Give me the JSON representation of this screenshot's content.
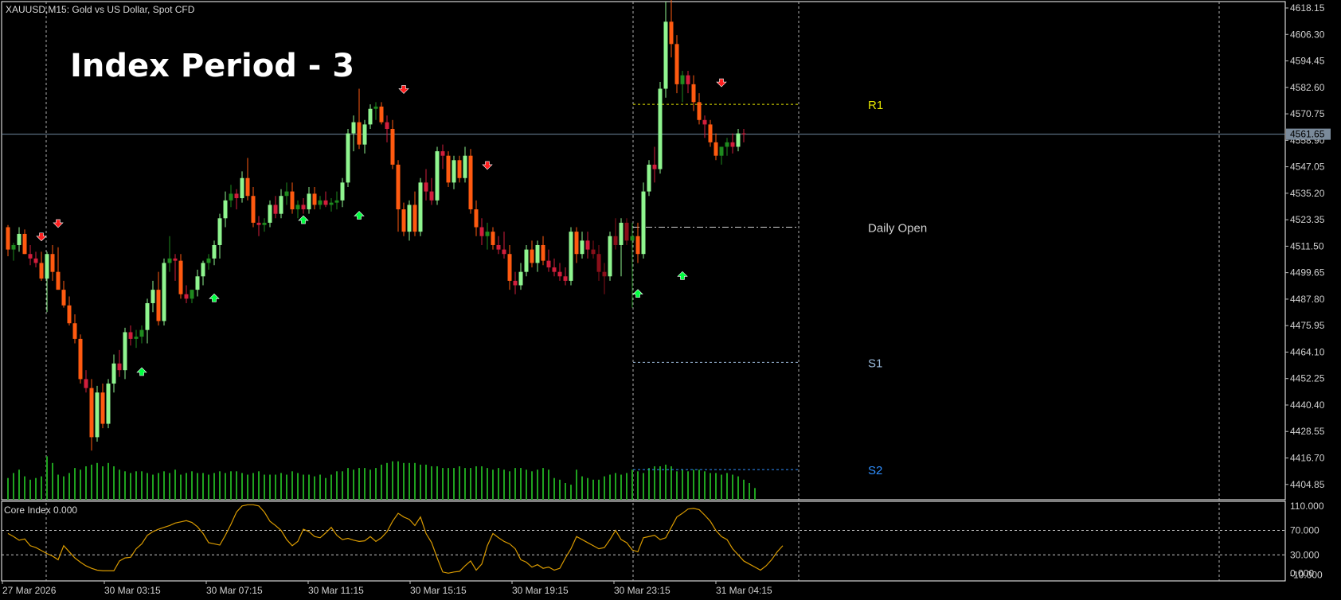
{
  "header": {
    "symbol_info": "XAUUSD,M15:  Gold vs US Dollar, Spot CFD",
    "overlay_title": "Index Period - 3"
  },
  "colors": {
    "bull_strong": "#8ff58f",
    "bull": "#1e8a1e",
    "bear_strong": "#ff5a10",
    "bear": "#d21e3c",
    "bear_dark": "#8a0f1a",
    "buy_arrow": "#00ff40",
    "sell_arrow": "#ff2020",
    "r1": "#e6e600",
    "s1": "#9ab8d8",
    "s2": "#2f8fff",
    "daily_open": "#d0d0d0",
    "core_line": "#d99a00",
    "volume": "#1fa31f"
  },
  "chart_data": {
    "type": "candlestick",
    "symbol": "XAUUSD",
    "timeframe": "M15",
    "current_price": "4561.65",
    "y_axis_ticks": [
      "4618.15",
      "4606.30",
      "4594.45",
      "4582.60",
      "4570.75",
      "4558.90",
      "4547.05",
      "4535.20",
      "4523.35",
      "4511.50",
      "4499.65",
      "4487.80",
      "4475.95",
      "4464.10",
      "4452.25",
      "4440.40",
      "4428.55",
      "4416.70",
      "4404.85"
    ],
    "ylim": [
      4398,
      4621
    ],
    "x_axis_labels": [
      "27 Mar 2026",
      "30 Mar 03:15",
      "30 Mar 07:15",
      "30 Mar 11:15",
      "30 Mar 15:15",
      "30 Mar 19:15",
      "30 Mar 23:15",
      "31 Mar 04:15"
    ],
    "pivot_levels": [
      {
        "name": "R1",
        "value": 4575.0
      },
      {
        "name": "Daily Open",
        "value": 4520.0
      },
      {
        "name": "S1",
        "value": 4459.5
      },
      {
        "name": "S2",
        "value": 4411.5
      }
    ],
    "candles": [
      [
        4520,
        4521,
        4507,
        4510
      ],
      [
        4510,
        4513,
        4505,
        4512
      ],
      [
        4512,
        4520,
        4509,
        4517
      ],
      [
        4517,
        4519,
        4508,
        4508
      ],
      [
        4508,
        4512,
        4503,
        4506
      ],
      [
        4506,
        4509,
        4502,
        4504
      ],
      [
        4504,
        4509,
        4496,
        4497
      ],
      [
        4497,
        4509,
        4482,
        4508
      ],
      [
        4508,
        4512,
        4496,
        4500
      ],
      [
        4500,
        4511,
        4492,
        4492
      ],
      [
        4492,
        4496,
        4484,
        4485
      ],
      [
        4485,
        4489,
        4476,
        4477
      ],
      [
        4477,
        4481,
        4468,
        4470
      ],
      [
        4470,
        4472,
        4450,
        4452
      ],
      [
        4452,
        4456,
        4446,
        4448
      ],
      [
        4448,
        4452,
        4420,
        4426
      ],
      [
        4426,
        4449,
        4424,
        4446
      ],
      [
        4446,
        4450,
        4430,
        4432
      ],
      [
        4432,
        4452,
        4430,
        4450
      ],
      [
        4450,
        4463,
        4446,
        4459
      ],
      [
        4459,
        4465,
        4453,
        4456
      ],
      [
        4456,
        4475,
        4452,
        4473
      ],
      [
        4473,
        4476,
        4467,
        4470
      ],
      [
        4470,
        4474,
        4466,
        4471
      ],
      [
        4471,
        4476,
        4468,
        4474
      ],
      [
        4474,
        4488,
        4468,
        4486
      ],
      [
        4486,
        4496,
        4482,
        4492
      ],
      [
        4492,
        4500,
        4476,
        4478
      ],
      [
        4478,
        4506,
        4476,
        4504
      ],
      [
        4504,
        4516,
        4500,
        4506
      ],
      [
        4506,
        4508,
        4496,
        4505
      ],
      [
        4505,
        4508,
        4488,
        4490
      ],
      [
        4490,
        4494,
        4486,
        4488
      ],
      [
        4488,
        4492,
        4486,
        4492
      ],
      [
        4492,
        4501,
        4489,
        4498
      ],
      [
        4498,
        4505,
        4494,
        4504
      ],
      [
        4504,
        4508,
        4501,
        4506
      ],
      [
        4506,
        4514,
        4503,
        4512
      ],
      [
        4512,
        4526,
        4506,
        4524
      ],
      [
        4524,
        4536,
        4520,
        4532
      ],
      [
        4532,
        4539,
        4529,
        4535
      ],
      [
        4535,
        4537,
        4528,
        4533
      ],
      [
        4533,
        4545,
        4531,
        4542
      ],
      [
        4542,
        4551,
        4532,
        4534
      ],
      [
        4534,
        4538,
        4520,
        4522
      ],
      [
        4522,
        4525,
        4516,
        4521
      ],
      [
        4521,
        4524,
        4518,
        4522
      ],
      [
        4522,
        4532,
        4520,
        4530
      ],
      [
        4530,
        4534,
        4524,
        4526
      ],
      [
        4526,
        4537,
        4524,
        4534
      ],
      [
        4534,
        4540,
        4530,
        4536
      ],
      [
        4536,
        4540,
        4526,
        4528
      ],
      [
        4528,
        4532,
        4524,
        4530
      ],
      [
        4530,
        4533,
        4526,
        4528
      ],
      [
        4528,
        4538,
        4526,
        4535
      ],
      [
        4535,
        4538,
        4528,
        4530
      ],
      [
        4530,
        4534,
        4528,
        4532
      ],
      [
        4532,
        4536,
        4529,
        4530
      ],
      [
        4530,
        4533,
        4527,
        4531
      ],
      [
        4531,
        4536,
        4528,
        4532
      ],
      [
        4532,
        4542,
        4529,
        4540
      ],
      [
        4540,
        4564,
        4538,
        4562
      ],
      [
        4562,
        4570,
        4554,
        4567
      ],
      [
        4567,
        4582,
        4555,
        4557
      ],
      [
        4557,
        4568,
        4553,
        4566
      ],
      [
        4566,
        4575,
        4564,
        4573
      ],
      [
        4573,
        4576,
        4568,
        4574
      ],
      [
        4574,
        4576,
        4566,
        4567
      ],
      [
        4567,
        4570,
        4558,
        4564
      ],
      [
        4564,
        4568,
        4546,
        4548
      ],
      [
        4548,
        4550,
        4518,
        4528
      ],
      [
        4528,
        4531,
        4516,
        4518
      ],
      [
        4518,
        4532,
        4514,
        4530
      ],
      [
        4530,
        4536,
        4516,
        4518
      ],
      [
        4518,
        4542,
        4516,
        4540
      ],
      [
        4540,
        4546,
        4532,
        4536
      ],
      [
        4536,
        4542,
        4530,
        4532
      ],
      [
        4532,
        4556,
        4530,
        4554
      ],
      [
        4554,
        4557,
        4546,
        4552
      ],
      [
        4552,
        4554,
        4538,
        4540
      ],
      [
        4540,
        4552,
        4537,
        4550
      ],
      [
        4550,
        4552,
        4540,
        4542
      ],
      [
        4542,
        4556,
        4540,
        4552
      ],
      [
        4552,
        4555,
        4526,
        4528
      ],
      [
        4528,
        4532,
        4516,
        4520
      ],
      [
        4520,
        4524,
        4512,
        4516
      ],
      [
        4516,
        4522,
        4510,
        4518
      ],
      [
        4518,
        4520,
        4510,
        4512
      ],
      [
        4512,
        4516,
        4508,
        4510
      ],
      [
        4510,
        4518,
        4506,
        4508
      ],
      [
        4508,
        4512,
        4492,
        4496
      ],
      [
        4496,
        4500,
        4490,
        4494
      ],
      [
        4494,
        4504,
        4492,
        4500
      ],
      [
        4500,
        4512,
        4498,
        4510
      ],
      [
        4510,
        4514,
        4502,
        4504
      ],
      [
        4504,
        4514,
        4500,
        4512
      ],
      [
        4512,
        4516,
        4503,
        4505
      ],
      [
        4505,
        4510,
        4500,
        4502
      ],
      [
        4502,
        4506,
        4498,
        4500
      ],
      [
        4500,
        4504,
        4496,
        4498
      ],
      [
        4498,
        4502,
        4494,
        4496
      ],
      [
        4496,
        4520,
        4494,
        4518
      ],
      [
        4518,
        4520,
        4504,
        4508
      ],
      [
        4508,
        4518,
        4506,
        4514
      ],
      [
        4514,
        4518,
        4506,
        4510
      ],
      [
        4510,
        4514,
        4506,
        4508
      ],
      [
        4508,
        4512,
        4496,
        4500
      ],
      [
        4500,
        4504,
        4490,
        4498
      ],
      [
        4498,
        4518,
        4496,
        4516
      ],
      [
        4516,
        4524,
        4510,
        4512
      ],
      [
        4512,
        4524,
        4498,
        4522
      ],
      [
        4522,
        4524,
        4512,
        4514
      ],
      [
        4514,
        4522,
        4484,
        4516
      ],
      [
        4516,
        4522,
        4504,
        4508
      ],
      [
        4508,
        4540,
        4506,
        4536
      ],
      [
        4536,
        4550,
        4534,
        4548
      ],
      [
        4548,
        4556,
        4540,
        4546
      ],
      [
        4546,
        4585,
        4544,
        4582
      ],
      [
        4582,
        4621,
        4578,
        4612
      ],
      [
        4612,
        4622,
        4596,
        4602
      ],
      [
        4602,
        4606,
        4580,
        4584
      ],
      [
        4584,
        4590,
        4576,
        4588
      ],
      [
        4588,
        4590,
        4580,
        4584
      ],
      [
        4584,
        4588,
        4572,
        4576
      ],
      [
        4576,
        4580,
        4566,
        4568
      ],
      [
        4568,
        4570,
        4560,
        4566
      ],
      [
        4566,
        4568,
        4556,
        4558
      ],
      [
        4558,
        4562,
        4550,
        4552
      ],
      [
        4552,
        4556,
        4548,
        4556
      ],
      [
        4556,
        4560,
        4552,
        4558
      ],
      [
        4558,
        4562,
        4553,
        4556
      ],
      [
        4556,
        4564,
        4554,
        4562
      ],
      [
        4562,
        4564,
        4558,
        4561.65
      ]
    ],
    "volume": [
      13,
      16,
      18,
      14,
      12,
      13,
      14,
      26,
      22,
      15,
      14,
      16,
      19,
      18,
      20,
      21,
      22,
      20,
      22,
      20,
      18,
      17,
      16,
      17,
      17,
      16,
      15,
      16,
      17,
      16,
      18,
      15,
      16,
      17,
      16,
      16,
      15,
      16,
      17,
      16,
      17,
      17,
      16,
      15,
      16,
      17,
      15,
      15,
      15,
      16,
      15,
      17,
      16,
      15,
      15,
      14,
      15,
      13,
      15,
      17,
      17,
      19,
      18,
      19,
      19,
      18,
      19,
      21,
      22,
      23,
      23,
      22,
      22,
      22,
      21,
      21,
      20,
      20,
      19,
      19,
      19,
      20,
      19,
      19,
      20,
      20,
      19,
      18,
      19,
      18,
      17,
      19,
      19,
      18,
      17,
      18,
      19,
      18,
      13,
      12,
      10,
      9,
      18,
      14,
      13,
      12,
      12,
      14,
      15,
      16,
      15,
      16,
      18,
      17,
      16,
      19,
      20,
      20,
      21,
      20,
      17,
      18,
      17,
      18,
      18,
      17,
      16,
      16,
      15,
      16,
      15,
      14,
      12,
      10,
      7
    ],
    "buy_signals": [
      [
        24,
        4455
      ],
      [
        37,
        4488
      ],
      [
        53,
        4523
      ],
      [
        63,
        4525
      ],
      [
        113,
        4490
      ],
      [
        121,
        4498
      ]
    ],
    "sell_signals": [
      [
        6,
        4516
      ],
      [
        9,
        4522
      ],
      [
        71,
        4582
      ],
      [
        86,
        4548
      ],
      [
        128,
        4585
      ]
    ],
    "core_index": {
      "label": "Core Index 0.000",
      "levels": [
        70,
        30
      ],
      "ticks": [
        "110.000",
        "70.000",
        "30.000",
        "0.000",
        "-10.000"
      ],
      "ylim": [
        -10,
        115
      ],
      "values": [
        65,
        60,
        54,
        56,
        45,
        42,
        37,
        32,
        28,
        22,
        45,
        35,
        25,
        18,
        12,
        8,
        5,
        4,
        4,
        4,
        20,
        25,
        26,
        40,
        48,
        62,
        68,
        72,
        75,
        78,
        82,
        84,
        86,
        83,
        76,
        65,
        50,
        48,
        46,
        62,
        80,
        100,
        110,
        112,
        112,
        110,
        100,
        85,
        78,
        70,
        55,
        45,
        52,
        72,
        68,
        60,
        58,
        66,
        75,
        62,
        55,
        57,
        54,
        52,
        53,
        60,
        52,
        58,
        68,
        85,
        98,
        92,
        88,
        78,
        92,
        65,
        50,
        25,
        2,
        0,
        2,
        3,
        12,
        20,
        5,
        15,
        45,
        65,
        58,
        52,
        48,
        40,
        22,
        18,
        10,
        14,
        8,
        10,
        5,
        8,
        25,
        40,
        60,
        55,
        50,
        45,
        40,
        42,
        55,
        70,
        55,
        50,
        38,
        35,
        58,
        60,
        62,
        55,
        58,
        75,
        92,
        98,
        105,
        106,
        104,
        95,
        85,
        70,
        60,
        55,
        40,
        30,
        20,
        15,
        10,
        5,
        12,
        22,
        35,
        45
      ]
    }
  }
}
